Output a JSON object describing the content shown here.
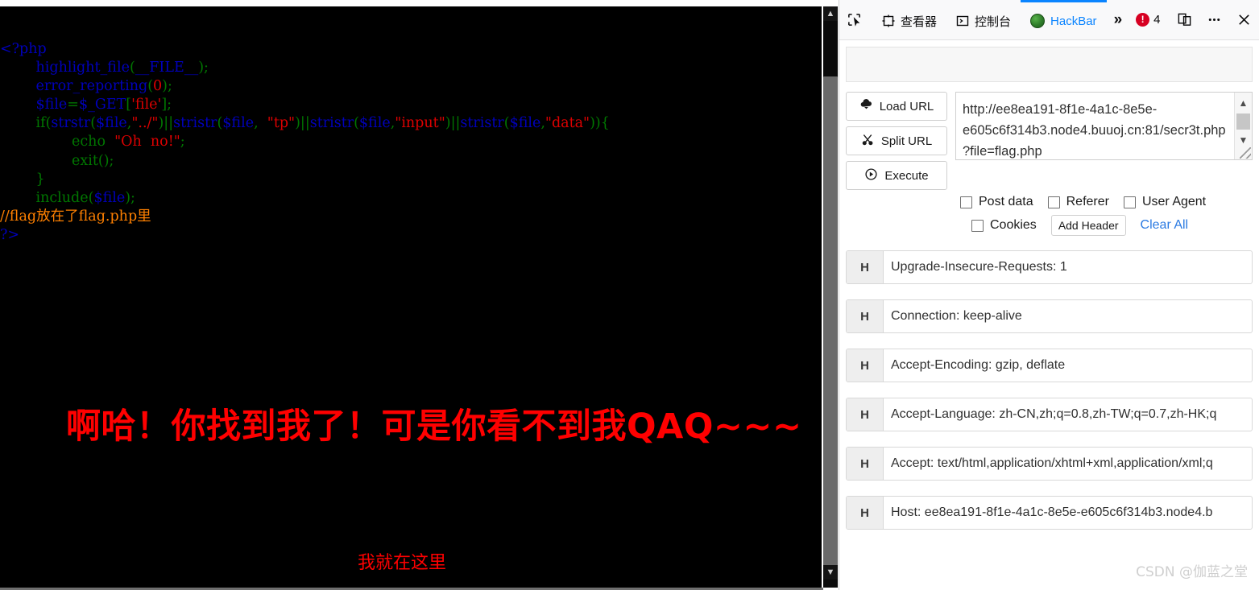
{
  "page": {
    "code_lines": [
      [
        {
          "t": "<?php",
          "c": "k"
        }
      ],
      [
        {
          "t": "        ",
          "c": "k"
        },
        {
          "t": "highlight_file",
          "c": "k"
        },
        {
          "t": "(",
          "c": "f"
        },
        {
          "t": "__FILE__",
          "c": "k"
        },
        {
          "t": ")",
          "c": "f"
        },
        {
          "t": ";",
          "c": "f"
        }
      ],
      [
        {
          "t": "        ",
          "c": "k"
        },
        {
          "t": "error_reporting",
          "c": "k"
        },
        {
          "t": "(",
          "c": "f"
        },
        {
          "t": "0",
          "c": "s"
        },
        {
          "t": ")",
          "c": "f"
        },
        {
          "t": ";",
          "c": "f"
        }
      ],
      [
        {
          "t": "        ",
          "c": "k"
        },
        {
          "t": "$file",
          "c": "k"
        },
        {
          "t": "=",
          "c": "f"
        },
        {
          "t": "$_GET",
          "c": "k"
        },
        {
          "t": "[",
          "c": "f"
        },
        {
          "t": "'file'",
          "c": "s"
        },
        {
          "t": "]",
          "c": "f"
        },
        {
          "t": ";",
          "c": "f"
        }
      ],
      [
        {
          "t": "        ",
          "c": "k"
        },
        {
          "t": "if",
          "c": "f"
        },
        {
          "t": "(",
          "c": "f"
        },
        {
          "t": "strstr",
          "c": "k"
        },
        {
          "t": "(",
          "c": "f"
        },
        {
          "t": "$file",
          "c": "k"
        },
        {
          "t": ",",
          "c": "f"
        },
        {
          "t": "\"../\"",
          "c": "s"
        },
        {
          "t": ")||",
          "c": "f"
        },
        {
          "t": "stristr",
          "c": "k"
        },
        {
          "t": "(",
          "c": "f"
        },
        {
          "t": "$file",
          "c": "k"
        },
        {
          "t": ",  ",
          "c": "f"
        },
        {
          "t": "\"tp\"",
          "c": "s"
        },
        {
          "t": ")||",
          "c": "f"
        },
        {
          "t": "stristr",
          "c": "k"
        },
        {
          "t": "(",
          "c": "f"
        },
        {
          "t": "$file",
          "c": "k"
        },
        {
          "t": ",",
          "c": "f"
        },
        {
          "t": "\"input\"",
          "c": "s"
        },
        {
          "t": ")||",
          "c": "f"
        },
        {
          "t": "stristr",
          "c": "k"
        },
        {
          "t": "(",
          "c": "f"
        },
        {
          "t": "$file",
          "c": "k"
        },
        {
          "t": ",",
          "c": "f"
        },
        {
          "t": "\"data\"",
          "c": "s"
        },
        {
          "t": ")){",
          "c": "f"
        }
      ],
      [
        {
          "t": "                ",
          "c": "k"
        },
        {
          "t": "echo ",
          "c": "f"
        },
        {
          "t": " \"Oh  no!\"",
          "c": "s"
        },
        {
          "t": ";",
          "c": "f"
        }
      ],
      [
        {
          "t": "                ",
          "c": "k"
        },
        {
          "t": "exit",
          "c": "f"
        },
        {
          "t": "()",
          "c": "f"
        },
        {
          "t": ";",
          "c": "f"
        }
      ],
      [
        {
          "t": "        ",
          "c": "k"
        },
        {
          "t": "}",
          "c": "f"
        }
      ],
      [
        {
          "t": "        ",
          "c": "k"
        },
        {
          "t": "include",
          "c": "f"
        },
        {
          "t": "(",
          "c": "f"
        },
        {
          "t": "$file",
          "c": "k"
        },
        {
          "t": ")",
          "c": "f"
        },
        {
          "t": ";",
          "c": "f"
        }
      ],
      [
        {
          "t": "//flag放在了flag.php里",
          "c": "c"
        }
      ],
      [
        {
          "t": "?>",
          "c": "k"
        }
      ]
    ],
    "headline": "啊哈！你找到我了！可是你看不到我QAQ~~~",
    "subline": "我就在这里"
  },
  "devtools": {
    "picker_icon": "element-picker-icon",
    "tabs": [
      {
        "label": "查看器",
        "icon": "inspector-icon",
        "active": false
      },
      {
        "label": "控制台",
        "icon": "console-icon",
        "active": false
      },
      {
        "label": "HackBar",
        "icon": "hackbar-icon",
        "active": true
      }
    ],
    "overflow_label": "»",
    "error_count": "4",
    "error_mark": "!",
    "responsive_icon": "responsive-design-mode-icon",
    "menu_icon": "meatball-menu-icon",
    "close_icon": "close-icon",
    "accent": "#0a84ff",
    "error_color": "#d70022"
  },
  "hackbar": {
    "load_url_label": "Load URL",
    "split_url_label": "Split URL",
    "execute_label": "Execute",
    "url_value": "http://ee8ea191-8f1e-4a1c-8e5e-e605c6f314b3.node4.buuoj.cn:81/secr3t.php?file=flag.php",
    "url_placeholder": "",
    "options": [
      {
        "label": "Post data",
        "checked": false
      },
      {
        "label": "Referer",
        "checked": false
      },
      {
        "label": "User Agent",
        "checked": false
      },
      {
        "label": "Cookies",
        "checked": false
      }
    ],
    "add_header_label": "Add Header",
    "clear_all_label": "Clear All",
    "headers": [
      {
        "tag": "H",
        "value": "Upgrade-Insecure-Requests: 1"
      },
      {
        "tag": "H",
        "value": "Connection: keep-alive"
      },
      {
        "tag": "H",
        "value": "Accept-Encoding: gzip, deflate"
      },
      {
        "tag": "H",
        "value": "Accept-Language: zh-CN,zh;q=0.8,zh-TW;q=0.7,zh-HK;q"
      },
      {
        "tag": "H",
        "value": "Accept: text/html,application/xhtml+xml,application/xml;q"
      },
      {
        "tag": "H",
        "value": "Host: ee8ea191-8f1e-4a1c-8e5e-e605c6f314b3.node4.b"
      }
    ]
  },
  "watermark": "CSDN @伽蓝之堂"
}
